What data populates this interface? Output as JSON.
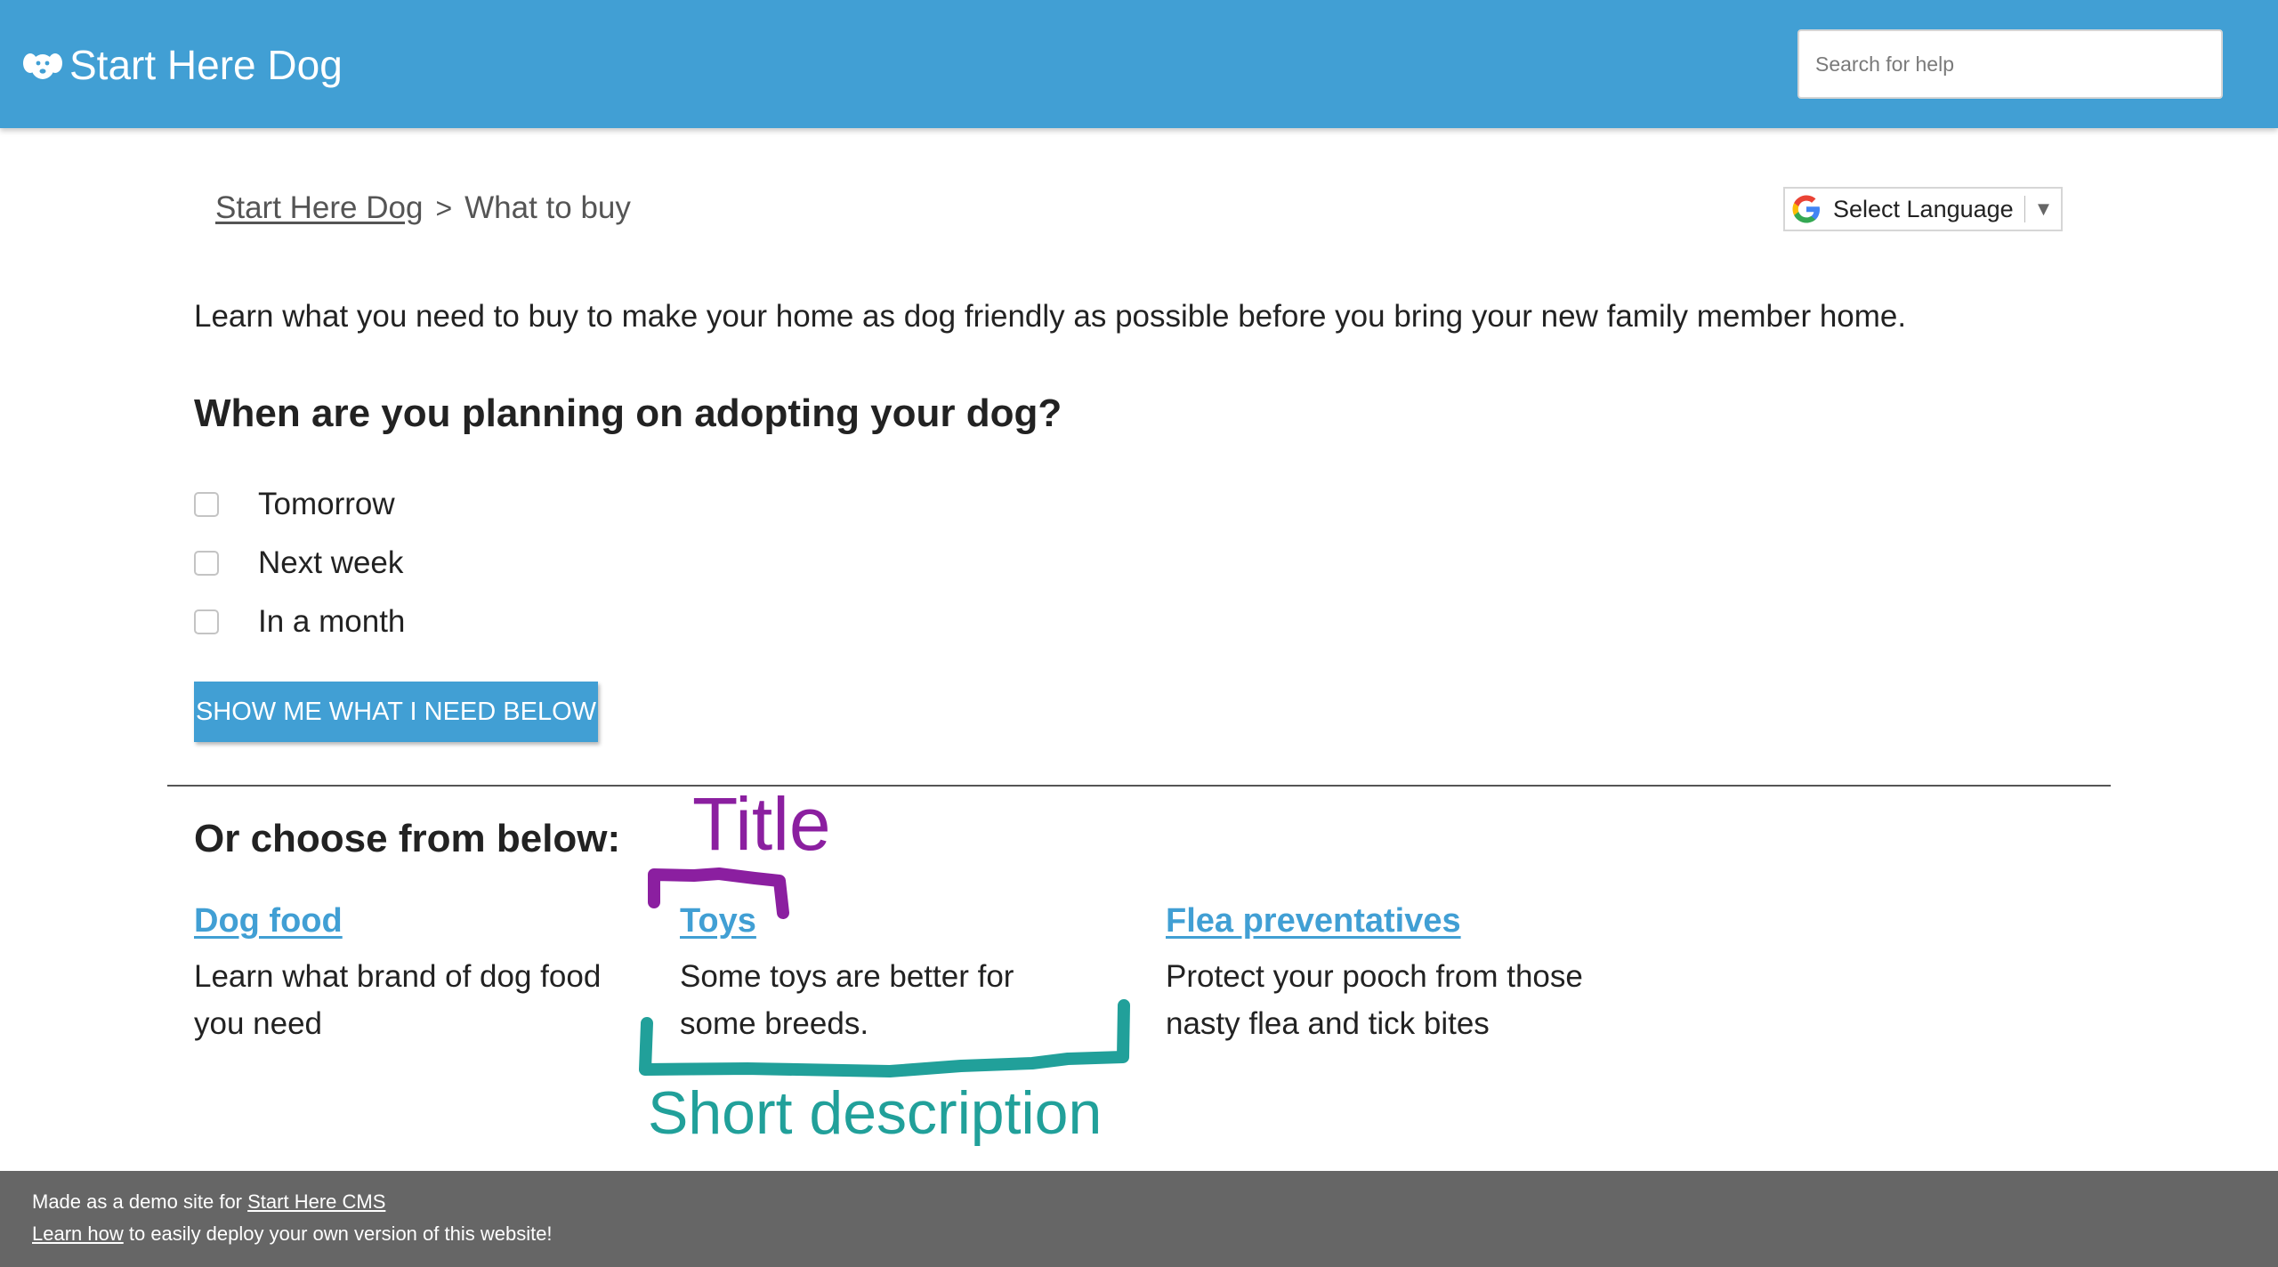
{
  "header": {
    "brand": "Start Here Dog",
    "brand_icon": "dog-icon",
    "search_placeholder": "Search for help",
    "color": "#419fd4"
  },
  "breadcrumb": {
    "home": "Start Here Dog",
    "separator": ">",
    "current": "What to buy"
  },
  "language": {
    "label": "Select Language",
    "arrow": "▼",
    "icon": "google-g-icon"
  },
  "main": {
    "intro": "Learn what you need to buy to make your home as dog friendly as possible before you bring your new family member home.",
    "question": "When are you planning on adopting your dog?",
    "options": [
      {
        "label": "Tomorrow",
        "checked": false
      },
      {
        "label": "Next week",
        "checked": false
      },
      {
        "label": "In a month",
        "checked": false
      }
    ],
    "button": "SHOW ME WHAT I NEED BELOW",
    "choose_heading": "Or choose from below:",
    "cards": [
      {
        "title": "Dog food",
        "desc": "Learn what brand of dog food you need"
      },
      {
        "title": "Toys",
        "desc": "Some toys are better for some breeds."
      },
      {
        "title": "Flea preventatives",
        "desc": "Protect your pooch from those nasty flea and tick bites"
      }
    ]
  },
  "annotations": {
    "title_label": "Title",
    "short_label": "Short description",
    "title_color": "#8b1fa0",
    "short_color": "#21a09a"
  },
  "footer": {
    "line1_prefix": "Made as a demo site for ",
    "line1_link": "Start Here CMS",
    "line2_link": "Learn how",
    "line2_suffix": " to easily deploy your own version of this website!"
  }
}
